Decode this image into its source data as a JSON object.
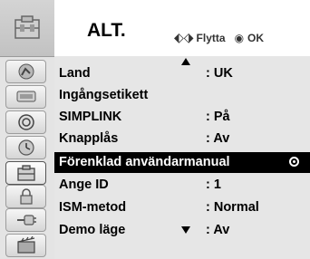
{
  "header": {
    "title": "ALT.",
    "move_hint": "Flytta",
    "ok_hint": "OK"
  },
  "icons": [
    {
      "name": "picture-icon"
    },
    {
      "name": "audio-icon"
    },
    {
      "name": "time-icon"
    },
    {
      "name": "option-icon"
    },
    {
      "name": "lock-icon"
    },
    {
      "name": "input-icon"
    },
    {
      "name": "usb-icon"
    },
    {
      "name": "movie-icon"
    }
  ],
  "menu": {
    "items": [
      {
        "label": "Land",
        "value": ": UK"
      },
      {
        "label": "Ingångsetikett",
        "value": ""
      },
      {
        "label": "SIMPLINK",
        "value": ": På"
      },
      {
        "label": "Knapplås",
        "value": ": Av"
      },
      {
        "label": "Förenklad användarmanual",
        "value": ""
      },
      {
        "label": "Ange ID",
        "value": ": 1"
      },
      {
        "label": "ISM-metod",
        "value": ": Normal"
      },
      {
        "label": "Demo läge",
        "value": ": Av"
      }
    ],
    "selected_index": 4
  },
  "colors": {
    "selected_bg": "#000000",
    "panel_bg": "#e6e6e6",
    "icon_col_bg": "#e4e4e4"
  }
}
